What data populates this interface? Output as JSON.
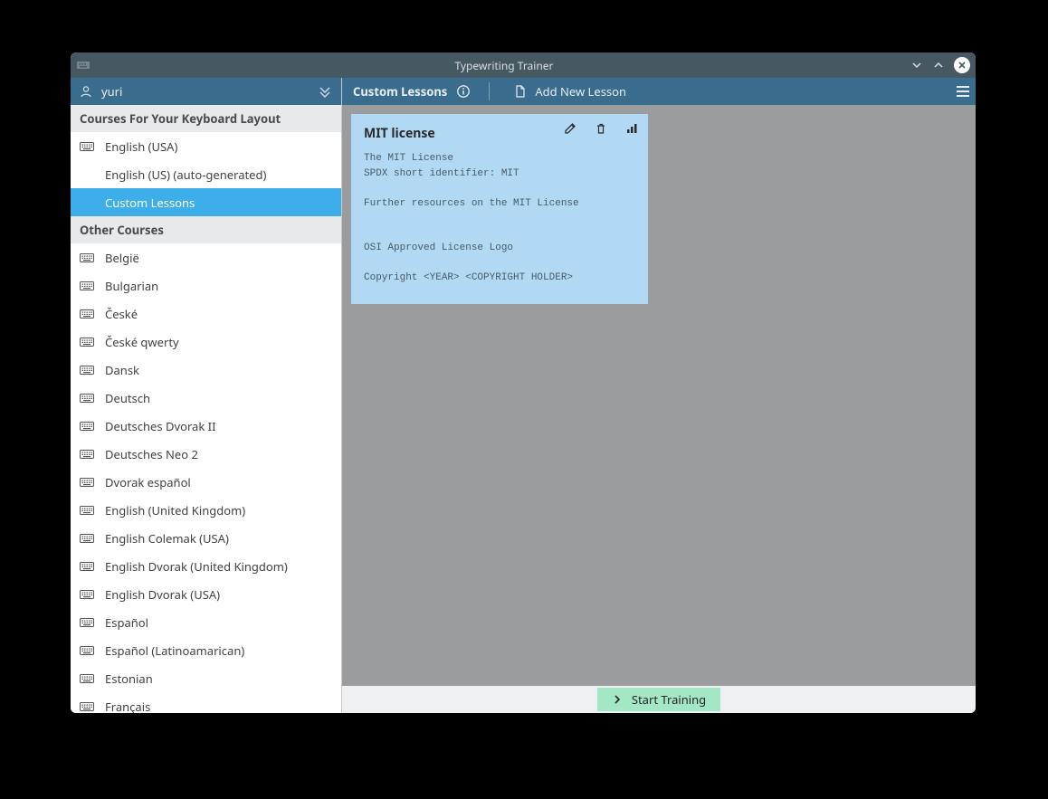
{
  "window": {
    "title": "Typewriting Trainer"
  },
  "user": {
    "name": "yuri"
  },
  "sidebar": {
    "section1_title": "Courses For Your Keyboard Layout",
    "section1_items": [
      {
        "label": "English (USA)",
        "icon": true
      },
      {
        "label": "English (US) (auto-generated)",
        "icon": false,
        "indent": true
      },
      {
        "label": "Custom Lessons",
        "icon": false,
        "indent": true,
        "selected": true
      }
    ],
    "section2_title": "Other Courses",
    "section2_items": [
      {
        "label": "België"
      },
      {
        "label": "Bulgarian"
      },
      {
        "label": "České"
      },
      {
        "label": "České qwerty"
      },
      {
        "label": "Dansk"
      },
      {
        "label": "Deutsch"
      },
      {
        "label": "Deutsches Dvorak II"
      },
      {
        "label": "Deutsches Neo 2"
      },
      {
        "label": "Dvorak español"
      },
      {
        "label": "English (United Kingdom)"
      },
      {
        "label": "English Colemak (USA)"
      },
      {
        "label": "English Dvorak (United Kingdom)"
      },
      {
        "label": "English Dvorak (USA)"
      },
      {
        "label": "Español"
      },
      {
        "label": "Español (Latinoamarican)"
      },
      {
        "label": "Estonian"
      },
      {
        "label": "Français"
      }
    ]
  },
  "toolbar": {
    "title": "Custom Lessons",
    "add_label": "Add New Lesson"
  },
  "lesson": {
    "title": "MIT license",
    "body": "The MIT License\nSPDX short identifier: MIT\n\nFurther resources on the MIT License\n\n\nOSI Approved License Logo\n\nCopyright <YEAR> <COPYRIGHT HOLDER>"
  },
  "footer": {
    "start_label": "Start Training"
  }
}
